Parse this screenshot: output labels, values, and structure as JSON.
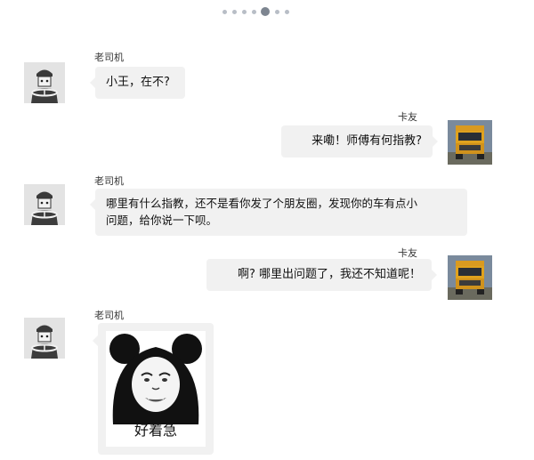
{
  "pager": {
    "count": 7,
    "active_index": 4
  },
  "messages": [
    {
      "side": "left",
      "sender": "老司机",
      "text": "小王，在不?"
    },
    {
      "side": "right",
      "sender": "卡友",
      "text": "来嘞！师傅有何指教?"
    },
    {
      "side": "left",
      "sender": "老司机",
      "text_lines": [
        "哪里有什么指教，还不是看你发了个朋友圈，发现你的车有点小",
        "问题，给你说一下呗。"
      ]
    },
    {
      "side": "right",
      "sender": "卡友",
      "text": "啊? 哪里出问题了，我还不知道呢！"
    },
    {
      "side": "left",
      "sender": "老司机",
      "sticker_caption": "好着急"
    }
  ],
  "icons": {
    "driver_avatar": "driver-avatar-icon",
    "truck_avatar": "truck-avatar-icon",
    "sticker": "panda-meme-sticker"
  }
}
